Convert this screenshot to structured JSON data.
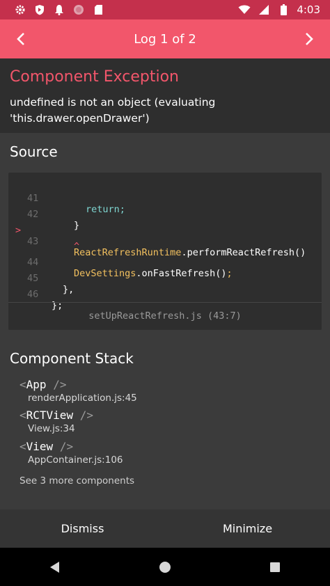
{
  "status_bar": {
    "time": "4:03",
    "left_icons": [
      "settings-icon",
      "shield-icon",
      "notification-bell-icon",
      "record-dot-icon",
      "sd-card-icon"
    ],
    "right_icons": [
      "wifi-icon",
      "signal-icon",
      "battery-icon"
    ]
  },
  "header": {
    "title": "Log 1 of 2",
    "prev_icon": "chevron-left-icon",
    "next_icon": "chevron-right-icon"
  },
  "exception": {
    "title": "Component Exception",
    "message": "undefined is not an object (evaluating 'this.drawer.openDrawer')"
  },
  "source": {
    "heading": "Source",
    "lines": [
      {
        "num": "41",
        "code": "return;"
      },
      {
        "num": "42",
        "code": "}"
      },
      {
        "num": "43",
        "code": "ReactRefreshRuntime.performReactRefresh()",
        "marker": ">",
        "caret": "^"
      },
      {
        "num": "44",
        "code": "DevSettings.onFastRefresh();"
      },
      {
        "num": "45",
        "code": "},"
      },
      {
        "num": "46",
        "code": "};"
      }
    ],
    "file": "setUpReactRefresh.js (43:7)"
  },
  "component_stack": {
    "heading": "Component Stack",
    "items": [
      {
        "open": "<",
        "name": "App",
        "close": "/>",
        "file": "renderApplication.js:45"
      },
      {
        "open": "<",
        "name": "RCTView",
        "close": "/>",
        "file": "View.js:34"
      },
      {
        "open": "<",
        "name": "View",
        "close": "/>",
        "file": "AppContainer.js:106"
      }
    ],
    "see_more": "See 3 more components"
  },
  "footer": {
    "dismiss": "Dismiss",
    "minimize": "Minimize"
  },
  "nav_bar": {
    "icons": [
      "back-triangle-icon",
      "home-circle-icon",
      "recents-square-icon"
    ]
  },
  "colors": {
    "accent": "#f2566b",
    "status_bar": "#c4304c",
    "keyword": "#7fd6d1",
    "identifier": "#f3c15f"
  }
}
